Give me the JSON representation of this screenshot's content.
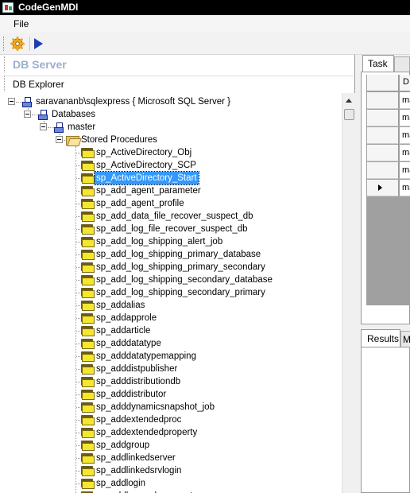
{
  "window": {
    "title": "CodeGenMDI"
  },
  "menu": {
    "file": "File"
  },
  "toolbar": {
    "settings_icon": "gear-icon",
    "run_icon": "play-icon",
    "accent": "#1c3fb0"
  },
  "left_panel": {
    "title": "DB Server",
    "explorer_title": "DB Explorer",
    "title_color": "#9bb0cc"
  },
  "tree": {
    "server": "saravananb\\sqlexpress { Microsoft SQL Server }",
    "databases": "Databases",
    "database": "master",
    "folder": "Stored Procedures",
    "selected": "sp_ActiveDirectory_Start",
    "procedures": [
      "sp_ActiveDirectory_Obj",
      "sp_ActiveDirectory_SCP",
      "sp_ActiveDirectory_Start",
      "sp_add_agent_parameter",
      "sp_add_agent_profile",
      "sp_add_data_file_recover_suspect_db",
      "sp_add_log_file_recover_suspect_db",
      "sp_add_log_shipping_alert_job",
      "sp_add_log_shipping_primary_database",
      "sp_add_log_shipping_primary_secondary",
      "sp_add_log_shipping_secondary_database",
      "sp_add_log_shipping_secondary_primary",
      "sp_addalias",
      "sp_addapprole",
      "sp_addarticle",
      "sp_adddatatype",
      "sp_adddatatypemapping",
      "sp_adddistpublisher",
      "sp_adddistributiondb",
      "sp_adddistributor",
      "sp_adddynamicsnapshot_job",
      "sp_addextendedproc",
      "sp_addextendedproperty",
      "sp_addgroup",
      "sp_addlinkedserver",
      "sp_addlinkedsrvlogin",
      "sp_addlogin",
      "sp_addlogreader_agent"
    ]
  },
  "right_panel": {
    "task_tab": "Task",
    "grid_header": "D",
    "grid_rows": [
      "ma",
      "ma",
      "ma",
      "ma",
      "ma",
      "ma"
    ],
    "results_tab": "Results",
    "messages_tab": "M"
  }
}
